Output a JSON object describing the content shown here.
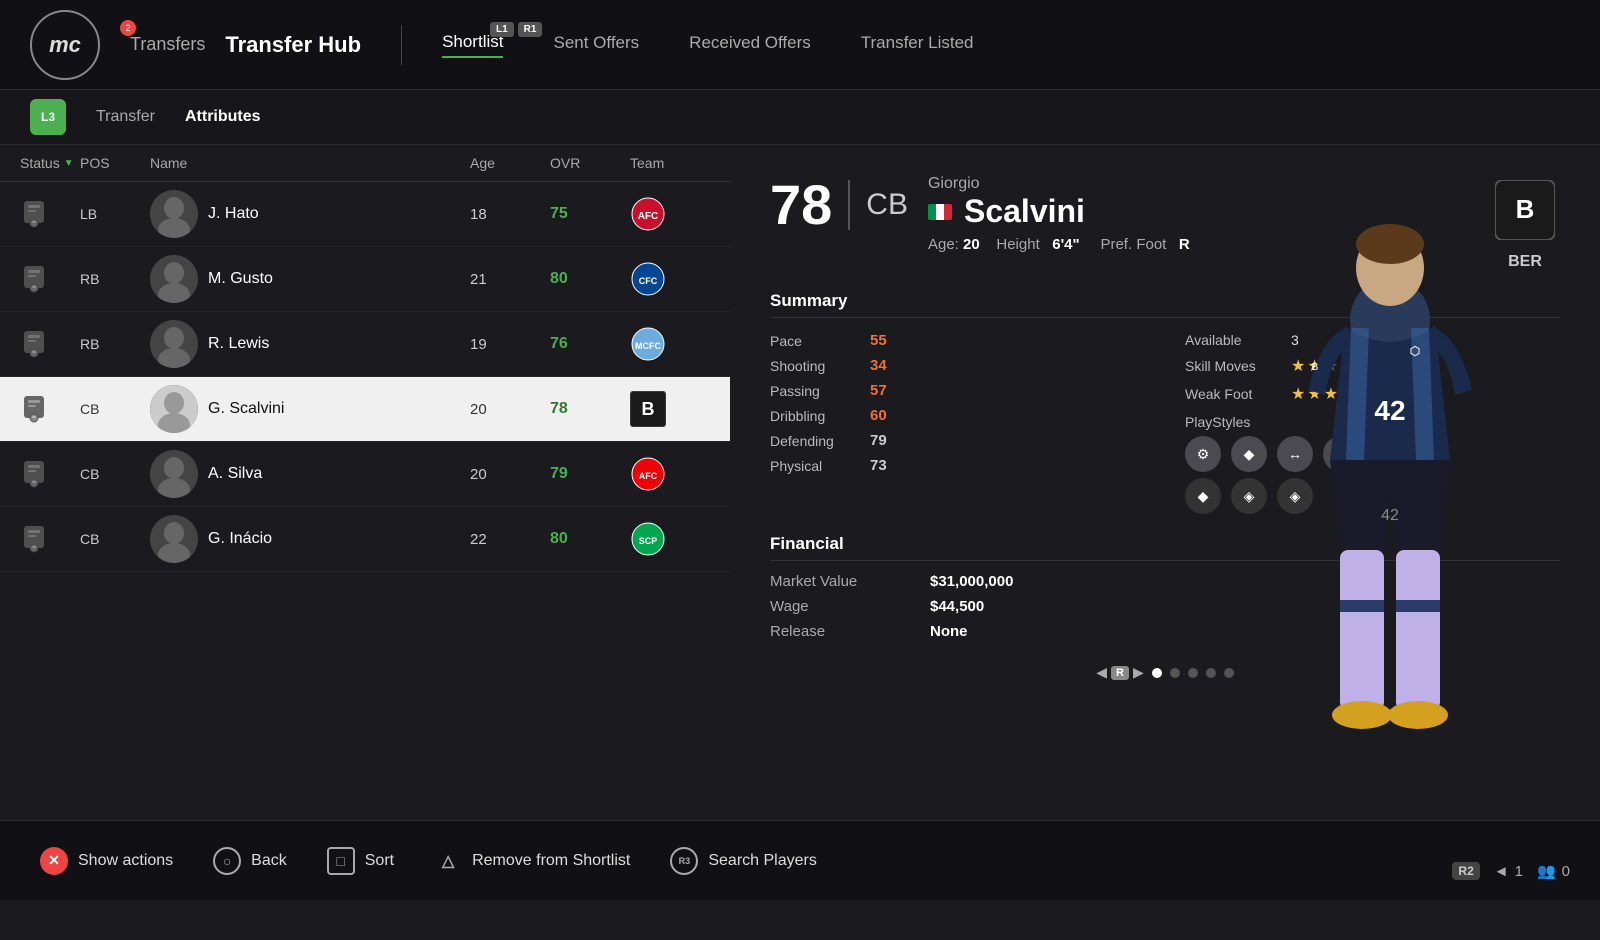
{
  "app": {
    "logo": "mc",
    "notification_count": "2"
  },
  "top_nav": {
    "transfers_label": "Transfers",
    "hub_label": "Transfer Hub",
    "controller_l1": "L1",
    "controller_r1": "R1",
    "tabs": [
      {
        "id": "shortlist",
        "label": "Shortlist",
        "active": true
      },
      {
        "id": "sent-offers",
        "label": "Sent Offers",
        "active": false
      },
      {
        "id": "received-offers",
        "label": "Received Offers",
        "active": false
      },
      {
        "id": "transfer-listed",
        "label": "Transfer Listed",
        "active": false
      }
    ]
  },
  "sub_nav": {
    "icon_label": "L3",
    "tabs": [
      {
        "id": "transfer",
        "label": "Transfer",
        "active": false
      },
      {
        "id": "attributes",
        "label": "Attributes",
        "active": true
      }
    ]
  },
  "list_headers": {
    "status": "Status",
    "pos": "POS",
    "name": "Name",
    "age": "Age",
    "ovr": "OVR",
    "team": "Team"
  },
  "players": [
    {
      "id": 1,
      "status_icon": "scout",
      "pos": "LB",
      "name": "J. Hato",
      "age": 18,
      "ovr": 75,
      "team": "ajax",
      "team_color": "#c8102e",
      "selected": false
    },
    {
      "id": 2,
      "status_icon": "scout",
      "pos": "RB",
      "name": "M. Gusto",
      "age": 21,
      "ovr": 80,
      "team": "chelsea",
      "team_color": "#034694",
      "selected": false
    },
    {
      "id": 3,
      "status_icon": "scout",
      "pos": "RB",
      "name": "R. Lewis",
      "age": 19,
      "ovr": 76,
      "team": "mancity",
      "team_color": "#6cabdd",
      "selected": false
    },
    {
      "id": 4,
      "status_icon": "scout",
      "pos": "CB",
      "name": "G. Scalvini",
      "age": 20,
      "ovr": 78,
      "team": "bayer",
      "team_color": "#333",
      "selected": true
    },
    {
      "id": 5,
      "status_icon": "scout",
      "pos": "CB",
      "name": "A. Silva",
      "age": 20,
      "ovr": 79,
      "team": "arsenal",
      "team_color": "#ef0107",
      "selected": false
    },
    {
      "id": 6,
      "status_icon": "scout",
      "pos": "CB",
      "name": "G. Inácio",
      "age": 22,
      "ovr": 80,
      "team": "sporting",
      "team_color": "#00a650",
      "selected": false
    }
  ],
  "selected_player": {
    "rating": "78",
    "position": "CB",
    "first_name": "Giorgio",
    "last_name": "Scalvini",
    "nationality": "Italy",
    "flag": "italy",
    "age_label": "Age:",
    "age": "20",
    "height_label": "Height",
    "height": "6'4\"",
    "pref_foot_label": "Pref. Foot",
    "pref_foot": "R",
    "club_abbr": "BER",
    "summary_label": "Summary",
    "stats": [
      {
        "name": "Pace",
        "val": "55",
        "type": "orange"
      },
      {
        "name": "Shooting",
        "val": "34",
        "type": "orange"
      },
      {
        "name": "Passing",
        "val": "57",
        "type": "orange"
      },
      {
        "name": "Dribbling",
        "val": "60",
        "type": "orange"
      },
      {
        "name": "Defending",
        "val": "79",
        "type": "good"
      },
      {
        "name": "Physical",
        "val": "73",
        "type": "good"
      }
    ],
    "skill_moves_label": "Skill Moves",
    "skill_moves_stars": 2,
    "skill_moves_max": 5,
    "weak_foot_label": "Weak Foot",
    "weak_foot_stars": 3,
    "weak_foot_max": 5,
    "available_label": "Available",
    "available_val": "3",
    "playstyles_label": "PlayStyles",
    "playstyles": [
      "⚙",
      "◆",
      "↔",
      "◈"
    ],
    "playstyles_bottom": [
      "◆",
      "◈",
      "◈"
    ],
    "financial_label": "Financial",
    "market_value_label": "Market Value",
    "market_value": "$31,000,000",
    "wage_label": "Wage",
    "wage": "$44,500",
    "release_label": "Release",
    "release": "None"
  },
  "pagination": {
    "current": 1,
    "total": 5,
    "r_label": "R"
  },
  "toolbar": {
    "show_actions_label": "Show actions",
    "back_label": "Back",
    "sort_label": "Sort",
    "remove_label": "Remove from Shortlist",
    "search_label": "Search Players"
  },
  "hud": {
    "r2_label": "R2",
    "count1": "1",
    "count2": "0"
  }
}
